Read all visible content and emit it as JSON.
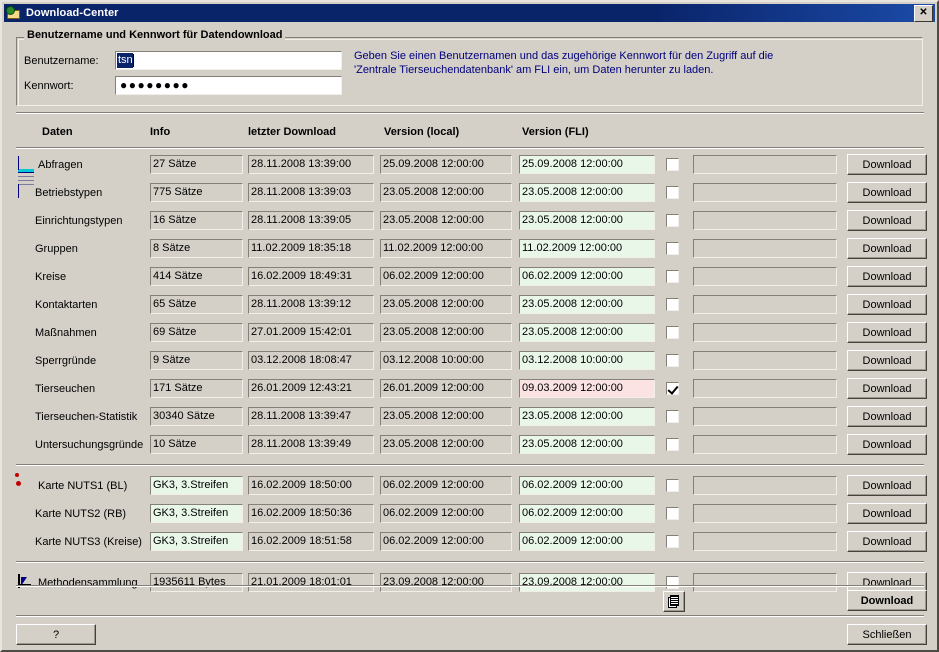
{
  "window": {
    "title": "Download-Center",
    "icon": "folder-globe-icon",
    "close_label": "✕"
  },
  "credentials": {
    "group_title": "Benutzername und Kennwort für Datendownload",
    "username_label": "Benutzername:",
    "username_value": "tsn",
    "password_label": "Kennwort:",
    "password_value": "●●●●●●●●",
    "hint": "Geben Sie einen Benutzernamen und das zugehörige Kennwort für den Zugriff auf die 'Zentrale Tierseuchendatenbank' am FLI ein, um Daten herunter zu laden."
  },
  "columns": {
    "daten": "Daten",
    "info": "Info",
    "letzter_download": "letzter Download",
    "version_local": "Version (local)",
    "version_fli": "Version (FLI)"
  },
  "row_button_label": "Download",
  "groups": [
    {
      "rows": [
        {
          "label": "Abfragen",
          "icon": "grid-table-icon",
          "info": "27 Sätze",
          "last_download": "28.11.2008 13:39:00",
          "version_local": "25.09.2008 12:00:00",
          "version_fli": "25.09.2008 12:00:00",
          "fli_differs": false,
          "checked": false,
          "progress": ""
        },
        {
          "label": "Betriebstypen",
          "icon": "",
          "info": "775 Sätze",
          "last_download": "28.11.2008 13:39:03",
          "version_local": "23.05.2008 12:00:00",
          "version_fli": "23.05.2008 12:00:00",
          "fli_differs": false,
          "checked": false,
          "progress": ""
        },
        {
          "label": "Einrichtungstypen",
          "icon": "",
          "info": "16 Sätze",
          "last_download": "28.11.2008 13:39:05",
          "version_local": "23.05.2008 12:00:00",
          "version_fli": "23.05.2008 12:00:00",
          "fli_differs": false,
          "checked": false,
          "progress": ""
        },
        {
          "label": "Gruppen",
          "icon": "",
          "info": "8 Sätze",
          "last_download": "11.02.2009 18:35:18",
          "version_local": "11.02.2009 12:00:00",
          "version_fli": "11.02.2009 12:00:00",
          "fli_differs": false,
          "checked": false,
          "progress": ""
        },
        {
          "label": "Kreise",
          "icon": "",
          "info": "414 Sätze",
          "last_download": "16.02.2009 18:49:31",
          "version_local": "06.02.2009 12:00:00",
          "version_fli": "06.02.2009 12:00:00",
          "fli_differs": false,
          "checked": false,
          "progress": ""
        },
        {
          "label": "Kontaktarten",
          "icon": "",
          "info": "65 Sätze",
          "last_download": "28.11.2008 13:39:12",
          "version_local": "23.05.2008 12:00:00",
          "version_fli": "23.05.2008 12:00:00",
          "fli_differs": false,
          "checked": false,
          "progress": ""
        },
        {
          "label": "Maßnahmen",
          "icon": "",
          "info": "69 Sätze",
          "last_download": "27.01.2009 15:42:01",
          "version_local": "23.05.2008 12:00:00",
          "version_fli": "23.05.2008 12:00:00",
          "fli_differs": false,
          "checked": false,
          "progress": ""
        },
        {
          "label": "Sperrgründe",
          "icon": "",
          "info": "9 Sätze",
          "last_download": "03.12.2008 18:08:47",
          "version_local": "03.12.2008 10:00:00",
          "version_fli": "03.12.2008 10:00:00",
          "fli_differs": false,
          "checked": false,
          "progress": ""
        },
        {
          "label": "Tierseuchen",
          "icon": "",
          "info": "171 Sätze",
          "last_download": "26.01.2009 12:43:21",
          "version_local": "26.01.2009 12:00:00",
          "version_fli": "09.03.2009 12:00:00",
          "fli_differs": true,
          "checked": true,
          "progress": ""
        },
        {
          "label": "Tierseuchen-Statistik",
          "icon": "",
          "info": "30340 Sätze",
          "last_download": "28.11.2008 13:39:47",
          "version_local": "23.05.2008 12:00:00",
          "version_fli": "23.05.2008 12:00:00",
          "fli_differs": false,
          "checked": false,
          "progress": ""
        },
        {
          "label": "Untersuchungsgründe",
          "icon": "",
          "info": "10 Sätze",
          "last_download": "28.11.2008 13:39:49",
          "version_local": "23.05.2008 12:00:00",
          "version_fli": "23.05.2008 12:00:00",
          "fli_differs": false,
          "checked": false,
          "progress": ""
        }
      ]
    },
    {
      "rows": [
        {
          "label": "Karte NUTS1 (BL)",
          "icon": "red-map-blob-icon",
          "info": "GK3, 3.Streifen",
          "info_green": true,
          "last_download": "16.02.2009 18:50:00",
          "version_local": "06.02.2009 12:00:00",
          "version_fli": "06.02.2009 12:00:00",
          "fli_differs": false,
          "checked": false,
          "progress": ""
        },
        {
          "label": "Karte NUTS2 (RB)",
          "icon": "",
          "info": "GK3, 3.Streifen",
          "info_green": true,
          "last_download": "16.02.2009 18:50:36",
          "version_local": "06.02.2009 12:00:00",
          "version_fli": "06.02.2009 12:00:00",
          "fli_differs": false,
          "checked": false,
          "progress": ""
        },
        {
          "label": "Karte NUTS3 (Kreise)",
          "icon": "",
          "info": "GK3, 3.Streifen",
          "info_green": true,
          "last_download": "16.02.2009 18:51:58",
          "version_local": "06.02.2009 12:00:00",
          "version_fli": "06.02.2009 12:00:00",
          "fli_differs": false,
          "checked": false,
          "progress": ""
        }
      ]
    },
    {
      "rows": [
        {
          "label": "Methodensammlung",
          "icon": "document-icon",
          "info": "1935611 Bytes",
          "last_download": "21.01.2009 18:01:01",
          "version_local": "23.09.2008 12:00:00",
          "version_fli": "23.09.2008 12:00:00",
          "fli_differs": false,
          "checked": false,
          "progress": ""
        }
      ]
    }
  ],
  "footer": {
    "stack_icon": "document-stack-icon",
    "download_all_label": "Download",
    "help_label": "?",
    "close_label": "Schließen"
  },
  "colors": {
    "face": "#d4d0c8",
    "titlebar": "#0a246a",
    "hint_text": "#00007c",
    "field_ok_bg": "#e9f7e9",
    "field_diff_bg": "#fbe3e3",
    "accent_red": "#c00000"
  }
}
